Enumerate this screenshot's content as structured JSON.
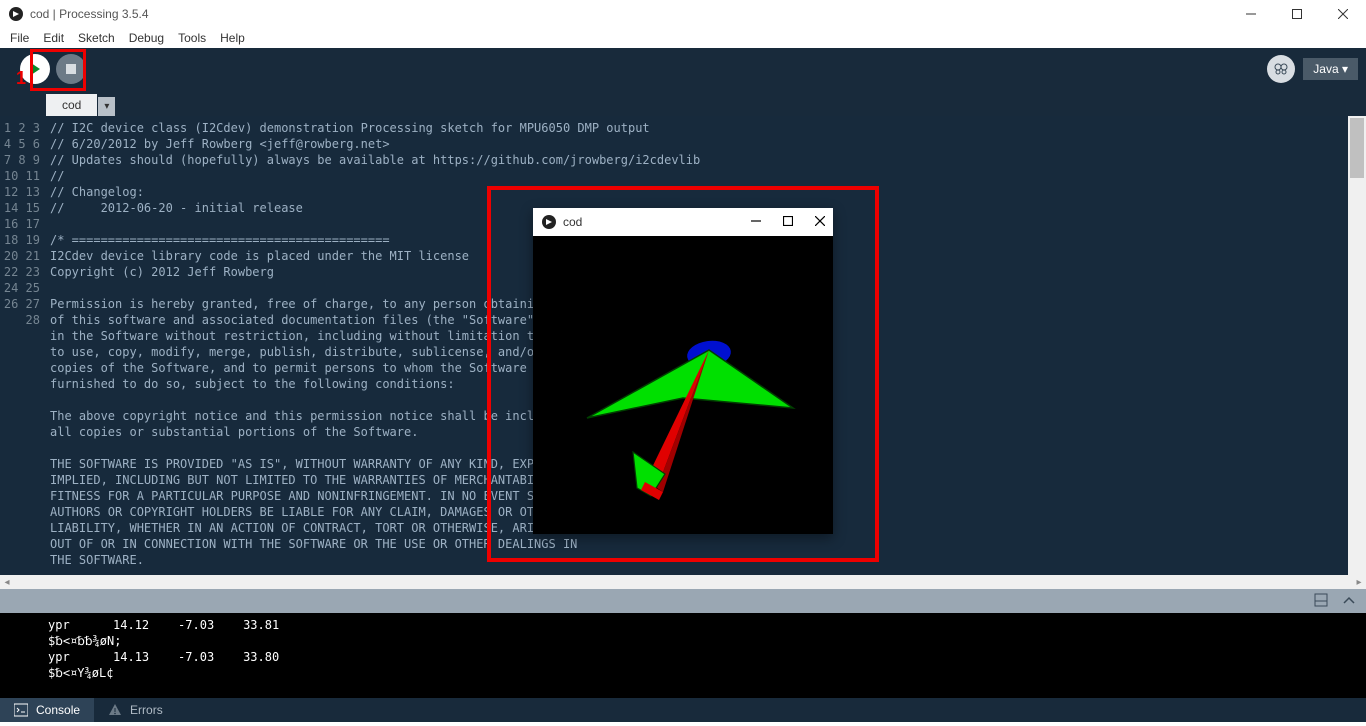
{
  "title": "cod | Processing 3.5.4",
  "menu": [
    "File",
    "Edit",
    "Sketch",
    "Debug",
    "Tools",
    "Help"
  ],
  "mode_label": "Java ▾",
  "tabs": {
    "active": "cod",
    "dropdown": "▾"
  },
  "code_lines": [
    "// I2C device class (I2Cdev) demonstration Processing sketch for MPU6050 DMP output",
    "// 6/20/2012 by Jeff Rowberg <jeff@rowberg.net>",
    "// Updates should (hopefully) always be available at https://github.com/jrowberg/i2cdevlib",
    "//",
    "// Changelog:",
    "//     2012-06-20 - initial release",
    "",
    "/* ============================================",
    "I2Cdev device library code is placed under the MIT license",
    "Copyright (c) 2012 Jeff Rowberg",
    "",
    "Permission is hereby granted, free of charge, to any person obtaining a copy",
    "of this software and associated documentation files (the \"Software\"), to deal",
    "in the Software without restriction, including without limitation the rights",
    "to use, copy, modify, merge, publish, distribute, sublicense, and/or sell",
    "copies of the Software, and to permit persons to whom the Software is",
    "furnished to do so, subject to the following conditions:",
    "",
    "The above copyright notice and this permission notice shall be included in",
    "all copies or substantial portions of the Software.",
    "",
    "THE SOFTWARE IS PROVIDED \"AS IS\", WITHOUT WARRANTY OF ANY KIND, EXPRESS OR",
    "IMPLIED, INCLUDING BUT NOT LIMITED TO THE WARRANTIES OF MERCHANTABILITY,",
    "FITNESS FOR A PARTICULAR PURPOSE AND NONINFRINGEMENT. IN NO EVENT SHALL THE",
    "AUTHORS OR COPYRIGHT HOLDERS BE LIABLE FOR ANY CLAIM, DAMAGES OR OTHER",
    "LIABILITY, WHETHER IN AN ACTION OF CONTRACT, TORT OR OTHERWISE, ARISING FROM,",
    "OUT OF OR IN CONNECTION WITH THE SOFTWARE OR THE USE OR OTHER DEALINGS IN",
    "THE SOFTWARE."
  ],
  "console_lines": [
    "ypr      14.12    -7.03    33.81",
    "$␢<¤␢␢¾øN;",
    "ypr      14.13    -7.03    33.80",
    "$␢<¤Y¾øL¢"
  ],
  "bottom_tabs": {
    "console": "Console",
    "errors": "Errors"
  },
  "run_window": {
    "title": "cod"
  },
  "annotation_label": "1"
}
